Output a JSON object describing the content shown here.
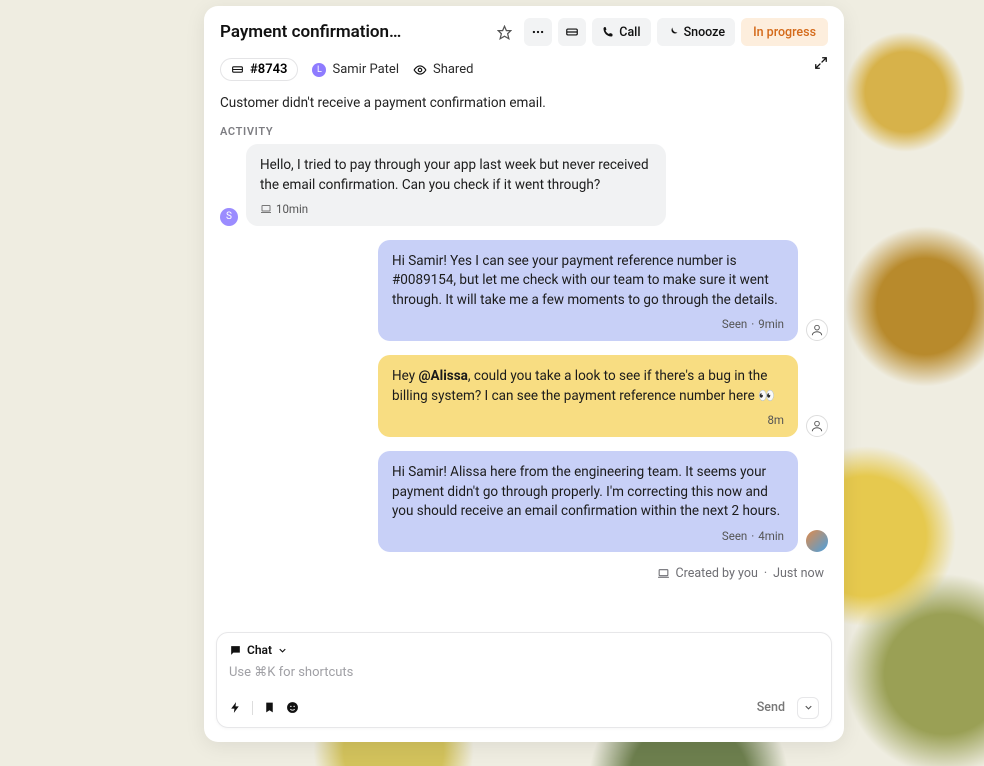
{
  "header": {
    "title": "Payment confirmation…",
    "call_label": "Call",
    "snooze_label": "Snooze",
    "status_label": "In progress"
  },
  "meta": {
    "ticket_id": "#8743",
    "author_initial": "L",
    "author_name": "Samir Patel",
    "shared_label": "Shared"
  },
  "summary": "Customer didn't receive a payment confirmation email.",
  "section_label": "ACTIVITY",
  "messages": {
    "m0": {
      "text": "Hello, I tried to pay through your app last week but never received the email confirmation. Can you check if it went through?",
      "avatar_initial": "S",
      "time": "10min"
    },
    "m1": {
      "text": "Hi Samir! Yes I can see your payment reference number is #0089154, but let me check with our team to make sure it went through. It will take me a few moments to go through the details.",
      "status": "Seen",
      "time": "9min"
    },
    "m2": {
      "prefix": "Hey ",
      "mention": "@Alissa",
      "rest": ", could you take a look to see if there's a bug in the billing system? I can see the payment reference number here 👀",
      "time": "8m"
    },
    "m3": {
      "text": "Hi Samir! Alissa here from the engineering team. It seems your payment didn't go through properly. I'm correcting this now and you should receive an email confirmation within the next 2 hours.",
      "status": "Seen",
      "time": "4min"
    }
  },
  "created_line": {
    "by": "Created by you",
    "when": "Just now"
  },
  "composer": {
    "mode": "Chat",
    "placeholder": "Use ⌘K for shortcuts",
    "send_label": "Send"
  }
}
